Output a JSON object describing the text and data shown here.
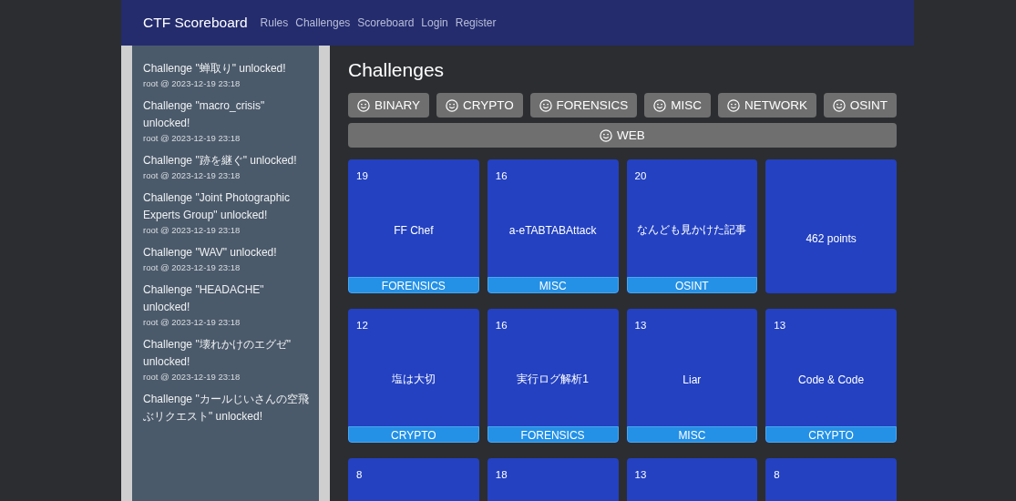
{
  "navbar": {
    "brand": "CTF Scoreboard",
    "links": [
      {
        "label": "Rules"
      },
      {
        "label": "Challenges"
      },
      {
        "label": "Scoreboard"
      },
      {
        "label": "Login"
      },
      {
        "label": "Register"
      }
    ]
  },
  "notifications": [
    {
      "message": "Challenge \"蝉取り\" unlocked!",
      "meta": "root @ 2023-12-19 23:18"
    },
    {
      "message": "Challenge \"macro_crisis\" unlocked!",
      "meta": "root @ 2023-12-19 23:18"
    },
    {
      "message": "Challenge \"跡を継ぐ\" unlocked!",
      "meta": "root @ 2023-12-19 23:18"
    },
    {
      "message": "Challenge \"Joint Photographic Experts Group\" unlocked!",
      "meta": "root @ 2023-12-19 23:18"
    },
    {
      "message": "Challenge \"WAV\" unlocked!",
      "meta": "root @ 2023-12-19 23:18"
    },
    {
      "message": "Challenge \"HEADACHE\" unlocked!",
      "meta": "root @ 2023-12-19 23:18"
    },
    {
      "message": "Challenge \"壊れかけのエグゼ\" unlocked!",
      "meta": "root @ 2023-12-19 23:18"
    },
    {
      "message": "Challenge \"カールじいさんの空飛ぶリクエスト\" unlocked!"
    }
  ],
  "heading": "Challenges",
  "filters": [
    {
      "label": "BINARY"
    },
    {
      "label": "CRYPTO"
    },
    {
      "label": "FORENSICS"
    },
    {
      "label": "MISC"
    },
    {
      "label": "NETWORK"
    },
    {
      "label": "OSINT"
    },
    {
      "label": "WEB"
    }
  ],
  "cards": [
    {
      "number": "19",
      "title": "FF Chef",
      "category": "FORENSICS"
    },
    {
      "number": "16",
      "title": "a-eTABTABAttack",
      "category": "MISC"
    },
    {
      "number": "20",
      "title": "なんども見かけた記事",
      "category": "OSINT"
    },
    {
      "title": "462 points"
    },
    {
      "number": "12",
      "title": "塩は大切",
      "category": "CRYPTO"
    },
    {
      "number": "16",
      "title": "実行ログ解析1",
      "category": "FORENSICS"
    },
    {
      "number": "13",
      "title": "Liar",
      "category": "MISC"
    },
    {
      "number": "13",
      "title": "Code & Code",
      "category": "CRYPTO"
    },
    {
      "number": "8"
    },
    {
      "number": "18"
    },
    {
      "number": "13"
    },
    {
      "number": "8"
    }
  ]
}
